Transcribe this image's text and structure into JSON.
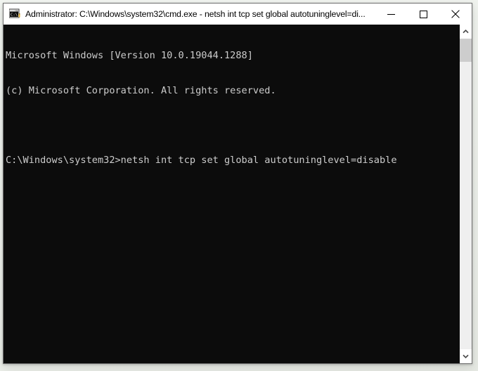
{
  "window": {
    "title": "Administrator: C:\\Windows\\system32\\cmd.exe - netsh  int tcp set global autotuninglevel=di...",
    "icon_name": "cmd-exe-icon",
    "controls": {
      "minimize_label": "Minimize",
      "maximize_label": "Maximize",
      "close_label": "Close"
    }
  },
  "console": {
    "background_color": "#0c0c0c",
    "text_color": "#cccccc",
    "lines": [
      "Microsoft Windows [Version 10.0.19044.1288]",
      "(c) Microsoft Corporation. All rights reserved.",
      "",
      "C:\\Windows\\system32>netsh int tcp set global autotuninglevel=disable"
    ]
  },
  "scrollbar": {
    "up_arrow_label": "Scroll up",
    "down_arrow_label": "Scroll down",
    "thumb_label": "Scroll thumb"
  }
}
